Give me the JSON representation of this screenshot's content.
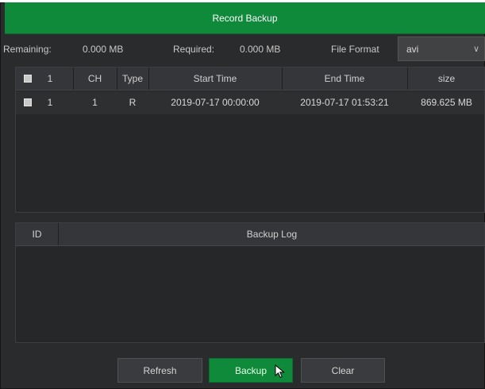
{
  "dialog": {
    "title": "Record Backup"
  },
  "info": {
    "remaining_label": "Remaining:",
    "remaining_value": "0.000 MB",
    "required_label": "Required:",
    "required_value": "0.000 MB",
    "format_label": "File Format",
    "format_value": "avi"
  },
  "files_table": {
    "headers": {
      "index": "1",
      "ch": "CH",
      "type": "Type",
      "start": "Start Time",
      "end": "End Time",
      "size": "size"
    },
    "rows": [
      {
        "index": "1",
        "ch": "1",
        "type": "R",
        "start": "2019-07-17 00:00:00",
        "end": "2019-07-17 01:53:21",
        "size": "869.625 MB"
      }
    ]
  },
  "log_table": {
    "headers": {
      "id": "ID",
      "log": "Backup Log"
    }
  },
  "buttons": {
    "refresh": "Refresh",
    "backup": "Backup",
    "clear": "Clear"
  },
  "colors": {
    "accent": "#0e8a3a",
    "background": "#2a2b2d"
  }
}
